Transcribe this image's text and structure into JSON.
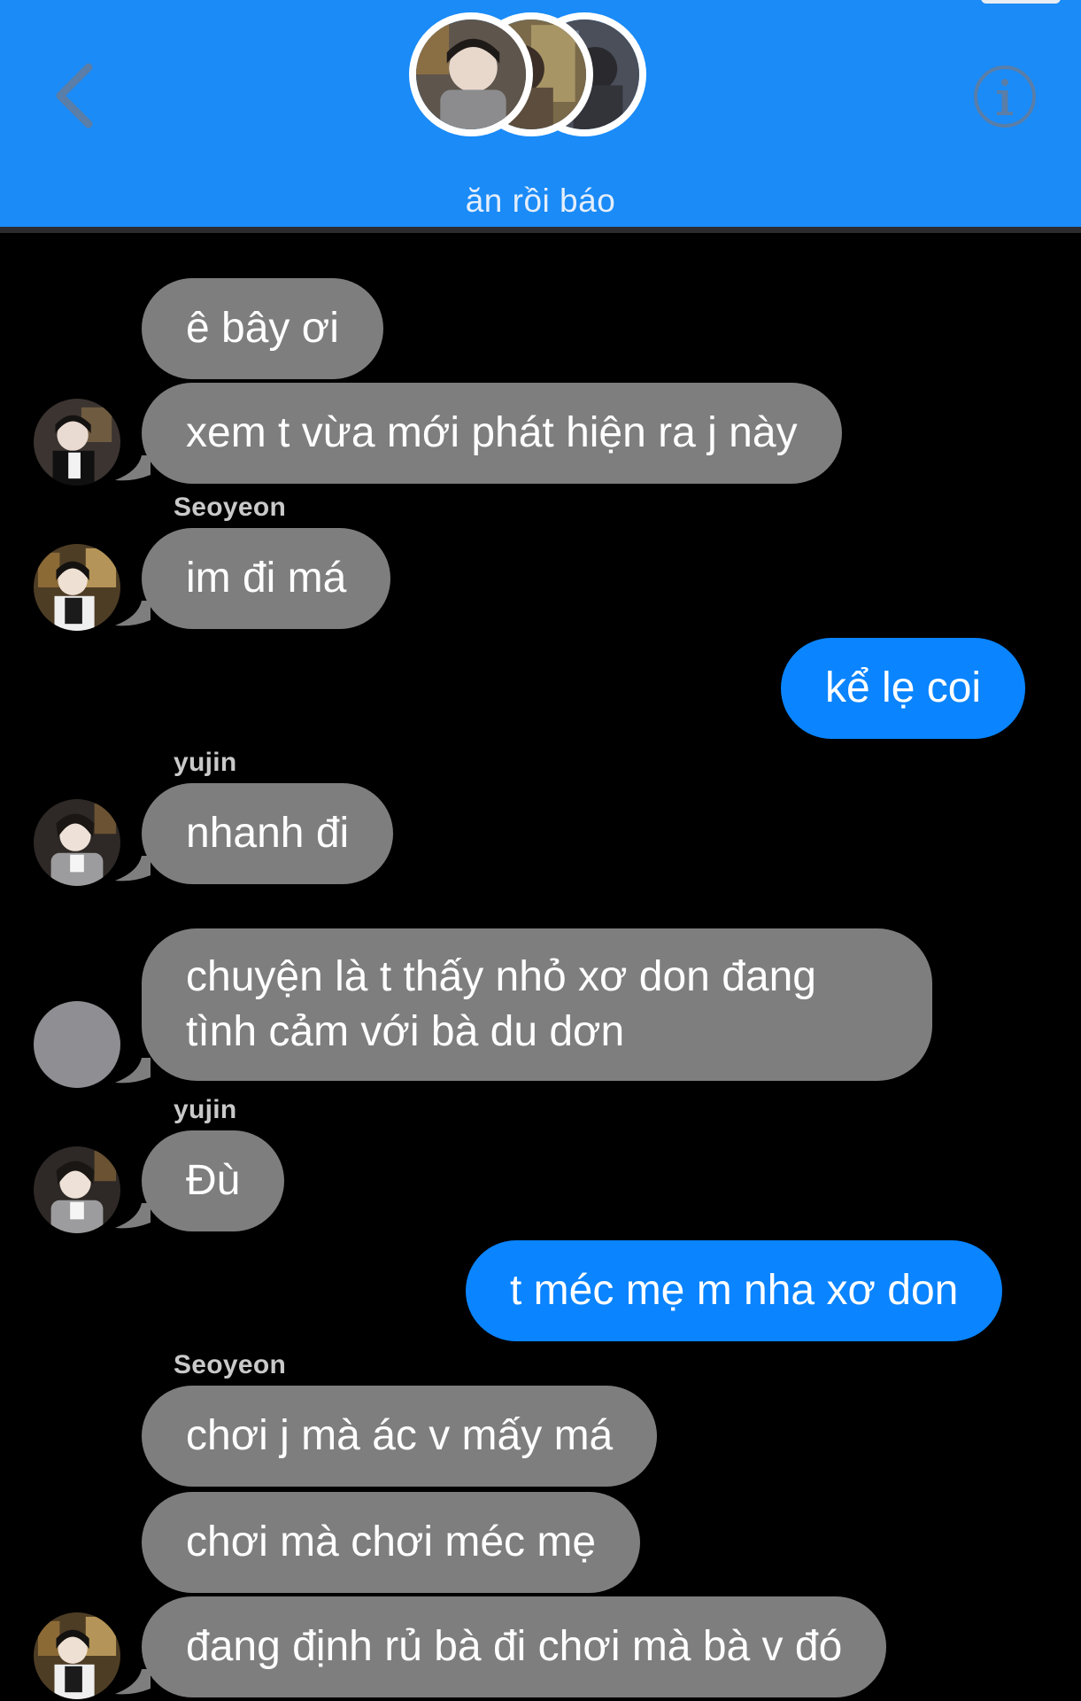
{
  "header": {
    "group_name": "ăn rồi báo",
    "back_icon": "chevron-left-icon",
    "info_icon": "info-icon",
    "color": "#1a8bf7"
  },
  "messages": [
    {
      "sender": "",
      "text": "ê bây ơi",
      "direction": "incoming"
    },
    {
      "sender": "",
      "text": "xem t vừa mới phát hiện ra j này",
      "direction": "incoming"
    },
    {
      "sender": "Seoyeon",
      "text": "im đi má",
      "direction": "incoming"
    },
    {
      "sender": "",
      "text": "kể lẹ coi",
      "direction": "outgoing"
    },
    {
      "sender": "yujin",
      "text": "nhanh đi",
      "direction": "incoming"
    },
    {
      "sender": "",
      "text": "chuyện là t thấy nhỏ xơ don đang tình cảm với bà du dơn",
      "direction": "incoming"
    },
    {
      "sender": "yujin",
      "text": "Đù",
      "direction": "incoming"
    },
    {
      "sender": "",
      "text": "t méc mẹ m nha xơ don",
      "direction": "outgoing"
    },
    {
      "sender": "Seoyeon",
      "text": "chơi j mà ác v mấy má",
      "direction": "incoming"
    },
    {
      "sender": "",
      "text": "chơi mà chơi méc mẹ",
      "direction": "incoming"
    },
    {
      "sender": "",
      "text": "đang định rủ bà đi chơi mà bà v đó",
      "direction": "incoming"
    }
  ],
  "colors": {
    "incoming_bubble": "#7e7e7e",
    "outgoing_bubble": "#0a84ff",
    "background": "#000000"
  }
}
